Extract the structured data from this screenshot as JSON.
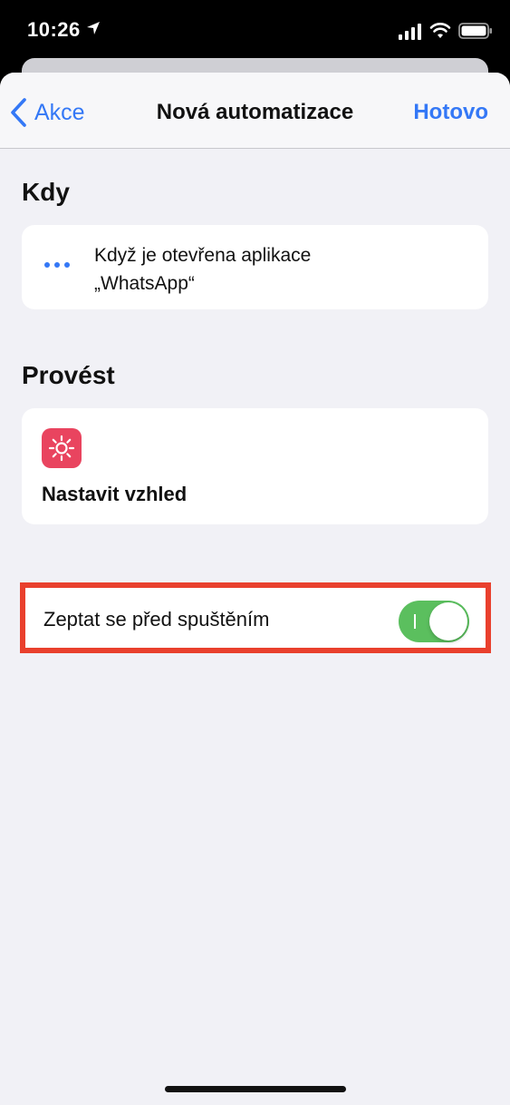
{
  "status_bar": {
    "time": "10:26",
    "icons": [
      "location-arrow-icon",
      "cellular-signal-icon",
      "wifi-icon",
      "battery-icon"
    ]
  },
  "nav": {
    "back_label": "Akce",
    "title": "Nová automatizace",
    "done_label": "Hotovo"
  },
  "when": {
    "section_title": "Kdy",
    "line1": "Když je otevřena aplikace",
    "line2": "„WhatsApp“",
    "icon": "ellipsis-icon"
  },
  "do": {
    "section_title": "Provést",
    "action_label": "Nastavit vzhled",
    "icon": "sun-icon"
  },
  "ask_before_running": {
    "label": "Zeptat se před spuštěním",
    "enabled": true
  },
  "colors": {
    "accent": "#3478f6",
    "toggle_on": "#5bbf5e",
    "highlight": "#e9402d",
    "app_icon": "#e9445f"
  }
}
